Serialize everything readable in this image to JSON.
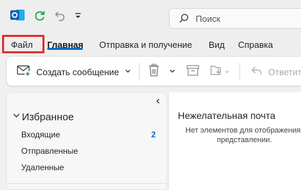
{
  "titlebar": {
    "search_placeholder": "Поиск"
  },
  "tabs": [
    {
      "label": "Файл"
    },
    {
      "label": "Главная"
    },
    {
      "label": "Отправка и получение"
    },
    {
      "label": "Вид"
    },
    {
      "label": "Справка"
    }
  ],
  "ribbon": {
    "new_message_label": "Создать сообщение",
    "reply_label": "Ответить"
  },
  "navpane": {
    "favorites_label": "Избранное",
    "folders": [
      {
        "label": "Входящие",
        "count": "2"
      },
      {
        "label": "Отправленные"
      },
      {
        "label": "Удаленные"
      }
    ]
  },
  "content": {
    "title": "Нежелательная почта",
    "empty_line1": "Нет элементов для отображения",
    "empty_line2": "представлении."
  },
  "colors": {
    "accent": "#0f6cbd",
    "highlight": "#e03131",
    "refresh_green": "#16a34a"
  },
  "icons": [
    "outlook-icon",
    "refresh-icon",
    "undo-icon",
    "customize-qat-icon",
    "search-icon",
    "new-mail-icon",
    "chevron-down-icon",
    "delete-icon",
    "archive-icon",
    "move-icon",
    "reply-icon",
    "chevron-left-icon"
  ]
}
